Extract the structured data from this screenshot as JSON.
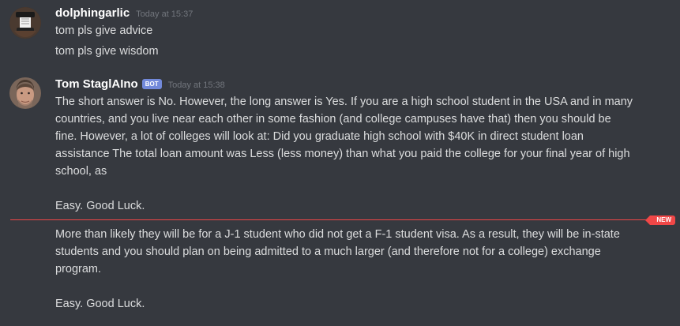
{
  "messages": [
    {
      "username": "dolphingarlic",
      "timestamp": "Today at 15:37",
      "lines": [
        "tom pls give advice",
        "tom pls give wisdom"
      ]
    },
    {
      "username": "Tom StaglAIno",
      "bot_tag": "BOT",
      "timestamp": "Today at 15:38",
      "lines": [
        "The short answer is No. However, the long answer is Yes. If you are a high school student in the USA and in many",
        "countries, and you live near each other in some fashion (and college campuses have that) then you should be",
        "fine. However, a lot of colleges will look at: Did you graduate high school with $40K in direct student loan",
        "assistance The total loan amount was Less (less money) than what you paid the college for your final year of high",
        "school, as",
        "Easy. Good Luck."
      ],
      "followup_lines": [
        "More than likely they will be for a J-1 student who did not get a F-1 student visa. As a result, they will be in-state",
        "students and you should plan on being admitted to a much larger (and therefore not for a college) exchange",
        "program.",
        "Easy. Good Luck."
      ]
    }
  ],
  "divider": {
    "label": "NEW",
    "color": "#f04747"
  },
  "colors": {
    "background": "#36393f",
    "text": "#dcddde",
    "username": "#ffffff",
    "timestamp": "#72767d",
    "bot_tag": "#7289da"
  }
}
